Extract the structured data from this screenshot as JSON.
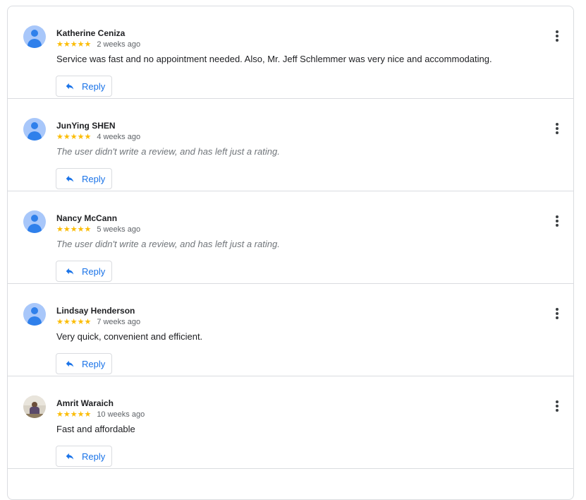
{
  "reviews": [
    {
      "name": "Katherine Ceniza",
      "stars": "★★★★★",
      "time": "2 weeks ago",
      "text": "Service was fast and no appointment needed. Also, Mr. Jeff Schlemmer was very nice and accommodating.",
      "reply_label": "Reply"
    },
    {
      "name": "JunYing SHEN",
      "stars": "★★★★★",
      "time": "4 weeks ago",
      "text": "The user didn't write a review, and has left just a rating.",
      "reply_label": "Reply"
    },
    {
      "name": "Nancy McCann",
      "stars": "★★★★★",
      "time": "5 weeks ago",
      "text": "The user didn't write a review, and has left just a rating.",
      "reply_label": "Reply"
    },
    {
      "name": "Lindsay Henderson",
      "stars": "★★★★★",
      "time": "7 weeks ago",
      "text": "Very quick, convenient and efficient.",
      "reply_label": "Reply"
    },
    {
      "name": "Amrit Waraich",
      "stars": "★★★★★",
      "time": "10 weeks ago",
      "text": "Fast and affordable",
      "reply_label": "Reply"
    }
  ],
  "colors": {
    "accent": "#1a73e8",
    "star": "#fbbc04",
    "avatar_bg": "#a8c7fa"
  },
  "icons": {
    "reply": "reply-arrow-icon",
    "more": "more-vert-icon",
    "avatar": "person-icon"
  }
}
